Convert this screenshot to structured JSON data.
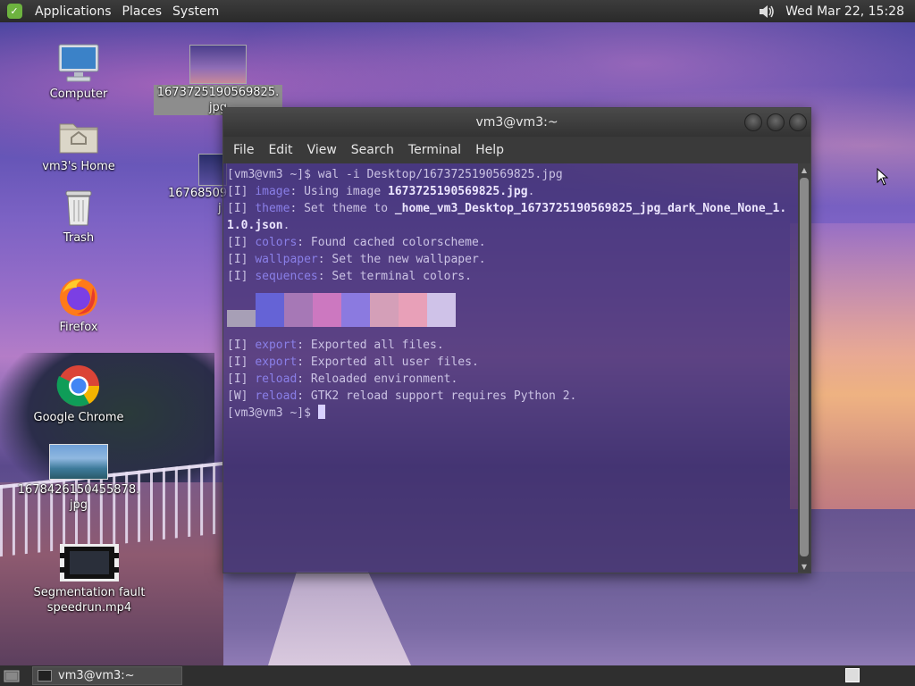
{
  "top_panel": {
    "menus": [
      "Applications",
      "Places",
      "System"
    ],
    "clock": "Wed Mar 22, 15:28"
  },
  "desktop_icons": [
    {
      "label": "Computer",
      "icon": "computer-icon"
    },
    {
      "label": "vm3's Home",
      "icon": "home-folder-icon"
    },
    {
      "label": "Trash",
      "icon": "trash-icon"
    },
    {
      "label": "Firefox",
      "icon": "firefox-icon"
    },
    {
      "label": "Google Chrome",
      "icon": "chrome-icon"
    },
    {
      "label_line1": "1678426150455878.",
      "label_line2": "jpg",
      "icon": "image-thumbnail-icon"
    },
    {
      "label_line1": "Segmentation fault",
      "label_line2": "speedrun.mp4",
      "icon": "video-thumbnail-icon"
    },
    {
      "label_line1": "1673725190569825.",
      "label_line2": "jpg",
      "icon": "image-thumbnail-icon",
      "selected": true
    },
    {
      "label_line1": "16768509",
      "label_line2": "j",
      "icon": "image-thumbnail-icon"
    }
  ],
  "terminal": {
    "title": "vm3@vm3:~",
    "menu": [
      "File",
      "Edit",
      "View",
      "Search",
      "Terminal",
      "Help"
    ],
    "lines": {
      "l1": "[vm3@vm3 ~]$ wal -i Desktop/1673725190569825.jpg",
      "l2_tag": "[I] ",
      "l2_key": "image",
      "l2_text": ": Using image ",
      "l2_bold": "1673725190569825.jpg",
      "l2_end": ".",
      "l3_tag": "[I] ",
      "l3_key": "theme",
      "l3_text": ": Set theme to ",
      "l3_bold": "_home_vm3_Desktop_1673725190569825_jpg_dark_None_None_1.",
      "l4_bold": "1.0.json",
      "l4_end": ".",
      "l5_tag": "[I] ",
      "l5_key": "colors",
      "l5_text": ": Found cached colorscheme.",
      "l6_tag": "[I] ",
      "l6_key": "wallpaper",
      "l6_text": ": Set the new wallpaper.",
      "l7_tag": "[I] ",
      "l7_key": "sequences",
      "l7_text": ": Set terminal colors.",
      "l8_tag": "[I] ",
      "l8_key": "export",
      "l8_text": ": Exported all files.",
      "l9_tag": "[I] ",
      "l9_key": "export",
      "l9_text": ": Exported all user files.",
      "l10_tag": "[I] ",
      "l10_key": "reload",
      "l10_text": ": Reloaded environment.",
      "l11_tag": "[W] ",
      "l11_key": "reload",
      "l11_text": ": GTK2 reload support requires Python 2.",
      "prompt": "[vm3@vm3 ~]$ "
    },
    "palette": [
      "#a79fb6",
      "#6563d6",
      "#a678b6",
      "#cc78c0",
      "#8b7ae0",
      "#d49fb8",
      "#e8a0b8",
      "#cfc2e8"
    ]
  },
  "taskbar": {
    "task_label": "vm3@vm3:~"
  }
}
